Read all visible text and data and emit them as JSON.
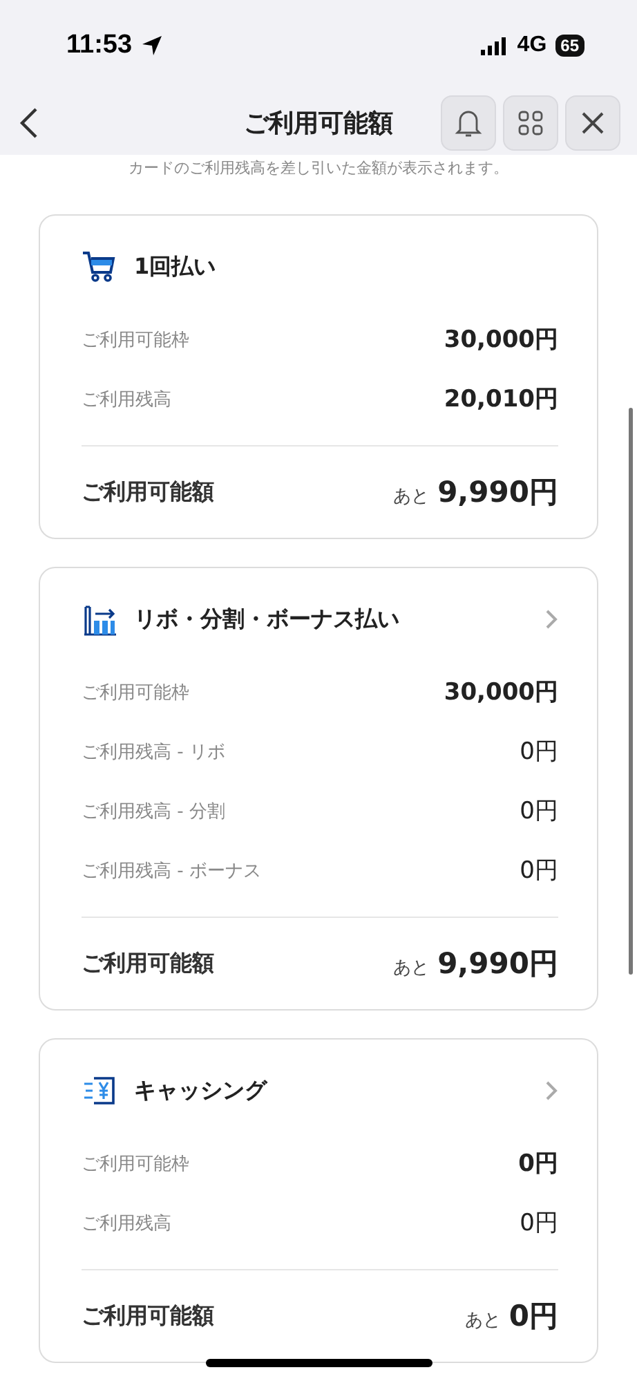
{
  "status_bar": {
    "time": "11:53",
    "network": "4G",
    "battery": "65"
  },
  "header": {
    "title": "ご利用可能額"
  },
  "note": "カードのご利用残高を差し引いた金額が表示されます。",
  "cards": [
    {
      "kind": "cart",
      "title": "1回払い",
      "chevron": false,
      "rows": [
        {
          "label": "ご利用可能枠",
          "value": "30,000円",
          "emphasis": true
        },
        {
          "label": "ご利用残高",
          "value": "20,010円",
          "emphasis": true
        }
      ],
      "total": {
        "label": "ご利用可能額",
        "prefix": "あと",
        "value": "9,990円"
      }
    },
    {
      "kind": "chart",
      "title": "リボ・分割・ボーナス払い",
      "chevron": true,
      "rows": [
        {
          "label": "ご利用可能枠",
          "value": "30,000円",
          "emphasis": true
        },
        {
          "label": "ご利用残高 - リボ",
          "value": "0円",
          "emphasis": false
        },
        {
          "label": "ご利用残高 - 分割",
          "value": "0円",
          "emphasis": false
        },
        {
          "label": "ご利用残高 - ボーナス",
          "value": "0円",
          "emphasis": false
        }
      ],
      "total": {
        "label": "ご利用可能額",
        "prefix": "あと",
        "value": "9,990円"
      }
    },
    {
      "kind": "cash",
      "title": "キャッシング",
      "chevron": true,
      "rows": [
        {
          "label": "ご利用可能枠",
          "value": "0円",
          "emphasis": true
        },
        {
          "label": "ご利用残高",
          "value": "0円",
          "emphasis": false
        }
      ],
      "total": {
        "label": "ご利用可能額",
        "prefix": "あと",
        "value": "0円"
      }
    }
  ]
}
